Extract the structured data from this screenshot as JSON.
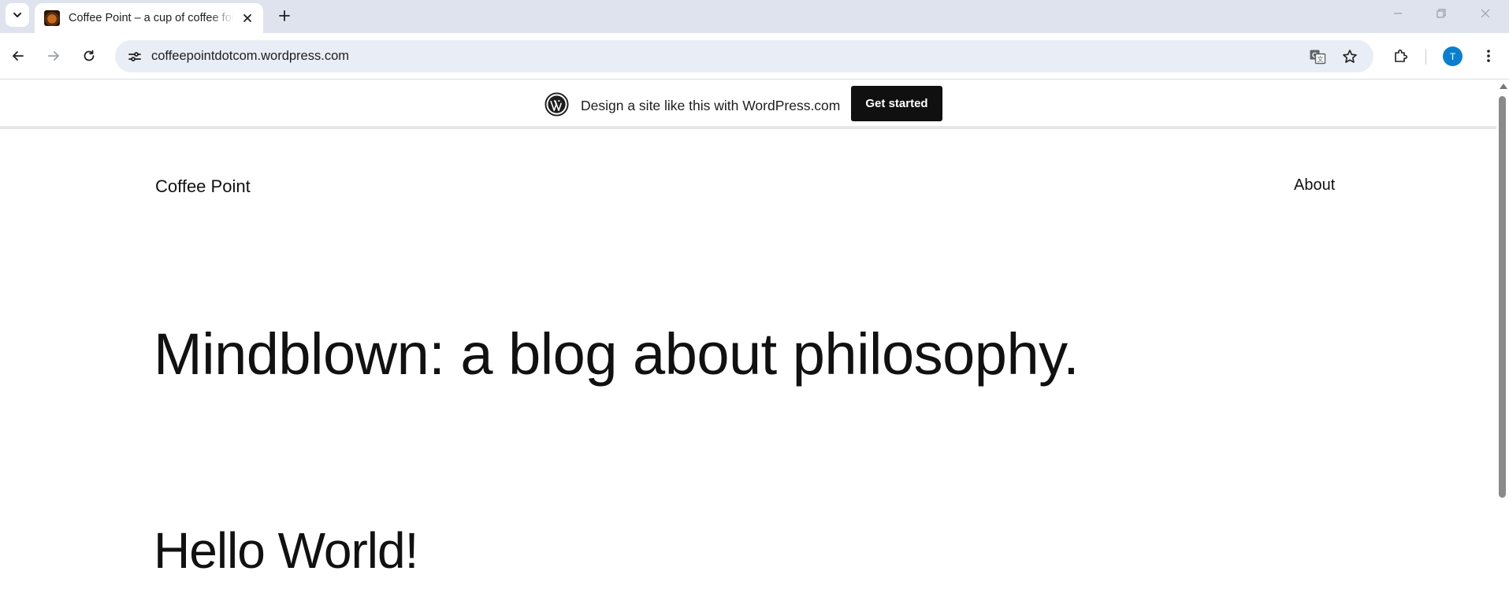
{
  "browser": {
    "tab": {
      "title": "Coffee Point – a cup of coffee for the mind"
    },
    "url": "coffeepointdotcom.wordpress.com",
    "profile_initial": "T"
  },
  "banner": {
    "text": "Design a site like this with WordPress.com",
    "button_label": "Get started"
  },
  "site": {
    "title": "Coffee Point",
    "nav": {
      "about_label": "About"
    }
  },
  "main": {
    "hero_heading": "Mindblown: a blog about philosophy.",
    "post_title": "Hello World!"
  }
}
